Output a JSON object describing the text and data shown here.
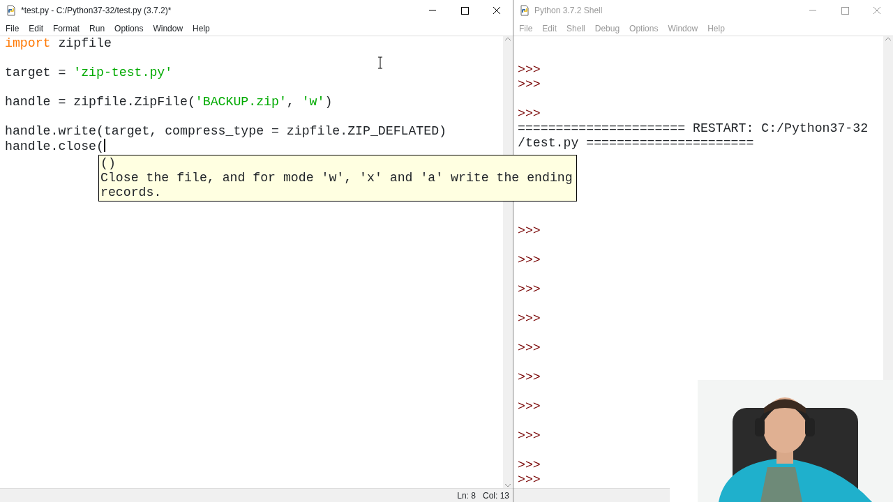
{
  "editor": {
    "title": "*test.py - C:/Python37-32/test.py (3.7.2)*",
    "active": true,
    "menu": [
      "File",
      "Edit",
      "Format",
      "Run",
      "Options",
      "Window",
      "Help"
    ],
    "lines": [
      {
        "kind": "code",
        "segments": [
          {
            "text": "import",
            "kind": "keyword"
          },
          {
            "text": " zipfile",
            "kind": "plain"
          }
        ]
      },
      {
        "kind": "blank"
      },
      {
        "kind": "code",
        "segments": [
          {
            "text": "target = ",
            "kind": "plain"
          },
          {
            "text": "'zip-test.py'",
            "kind": "string"
          }
        ]
      },
      {
        "kind": "blank"
      },
      {
        "kind": "code",
        "segments": [
          {
            "text": "handle = zipfile.ZipFile(",
            "kind": "plain"
          },
          {
            "text": "'BACKUP.zip'",
            "kind": "string"
          },
          {
            "text": ", ",
            "kind": "plain"
          },
          {
            "text": "'w'",
            "kind": "string"
          },
          {
            "text": ")",
            "kind": "plain"
          }
        ]
      },
      {
        "kind": "blank"
      },
      {
        "kind": "code",
        "segments": [
          {
            "text": "handle.write(target, compress_type = zipfile.ZIP_DEFLATED)",
            "kind": "plain"
          }
        ]
      },
      {
        "kind": "code",
        "caret": true,
        "segments": [
          {
            "text": "handle.close(",
            "kind": "plain"
          }
        ]
      }
    ],
    "status": {
      "line": "Ln: 8",
      "column": "Col: 13"
    }
  },
  "calltip": {
    "signature": "()",
    "doc": [
      "Close the file, and for mode 'w', 'x' and 'a' write the ending",
      "records."
    ]
  },
  "shell": {
    "title": "Python 3.7.2 Shell",
    "active": false,
    "menu": [
      "File",
      "Edit",
      "Shell",
      "Debug",
      "Options",
      "Window",
      "Help"
    ],
    "lines": [
      {
        "kind": "blank"
      },
      {
        "kind": "blank"
      },
      {
        "kind": "prompt",
        "text": ">>>"
      },
      {
        "kind": "prompt",
        "text": ">>>"
      },
      {
        "kind": "blank"
      },
      {
        "kind": "prompt",
        "text": ">>>"
      },
      {
        "kind": "output",
        "text": "====================== RESTART: C:/Python37-32"
      },
      {
        "kind": "output",
        "text": "/test.py ======================"
      },
      {
        "kind": "blank"
      },
      {
        "kind": "blank"
      },
      {
        "kind": "blank"
      },
      {
        "kind": "blank"
      },
      {
        "kind": "blank"
      },
      {
        "kind": "prompt",
        "text": ">>>"
      },
      {
        "kind": "blank"
      },
      {
        "kind": "prompt",
        "text": ">>>"
      },
      {
        "kind": "blank"
      },
      {
        "kind": "prompt",
        "text": ">>>"
      },
      {
        "kind": "blank"
      },
      {
        "kind": "prompt",
        "text": ">>>"
      },
      {
        "kind": "blank"
      },
      {
        "kind": "prompt",
        "text": ">>>"
      },
      {
        "kind": "blank"
      },
      {
        "kind": "prompt",
        "text": ">>>"
      },
      {
        "kind": "blank"
      },
      {
        "kind": "prompt",
        "text": ">>>"
      },
      {
        "kind": "blank"
      },
      {
        "kind": "prompt",
        "text": ">>>"
      },
      {
        "kind": "blank"
      },
      {
        "kind": "prompt",
        "text": ">>>"
      },
      {
        "kind": "prompt",
        "text": ">>>"
      }
    ]
  }
}
